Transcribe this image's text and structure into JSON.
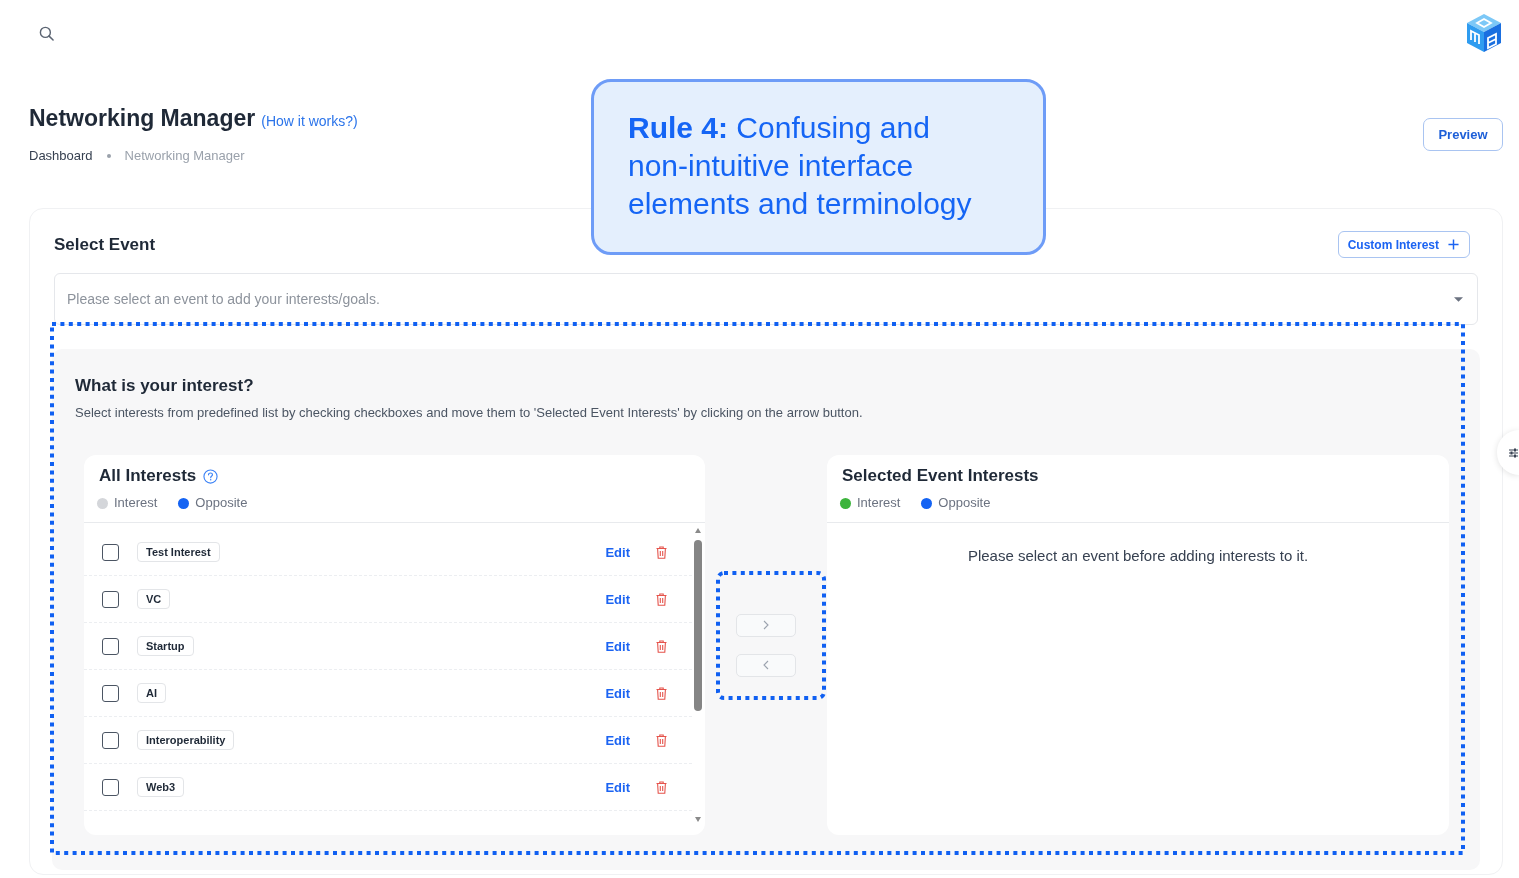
{
  "header": {
    "title": "Networking Manager",
    "help_link": "(How it works?)",
    "breadcrumb": [
      {
        "label": "Dashboard",
        "current": false
      },
      {
        "label": "Networking Manager",
        "current": true
      }
    ],
    "preview_button": "Preview"
  },
  "callout": {
    "text": "**Rule 4:** Confusing and non-intuitive interface elements and terminology"
  },
  "select_event": {
    "title": "Select Event",
    "custom_interest_button": "Custom Interest",
    "event_select": {
      "placeholder": "Please select an event to add your interests/goals."
    }
  },
  "interest_panel": {
    "title": "What is your interest?",
    "description": "Select interests from predefined list by checking checkboxes and move them to 'Selected Event Interests' by clicking on the arrow button.",
    "all_interests": {
      "title": "All Interests",
      "legend": [
        {
          "label": "Interest",
          "color": "#d4d6da"
        },
        {
          "label": "Opposite",
          "color": "#1463f3"
        }
      ],
      "items": [
        {
          "label": "Test Interest",
          "checked": false,
          "action": "Edit"
        },
        {
          "label": "VC",
          "checked": false,
          "action": "Edit"
        },
        {
          "label": "Startup",
          "checked": false,
          "action": "Edit"
        },
        {
          "label": "AI",
          "checked": false,
          "action": "Edit"
        },
        {
          "label": "Interoperability",
          "checked": false,
          "action": "Edit"
        },
        {
          "label": "Web3",
          "checked": false,
          "action": "Edit"
        }
      ]
    },
    "transfer_buttons": [
      {
        "kind": "move_right",
        "disabled": true
      },
      {
        "kind": "move_left",
        "disabled": true
      }
    ],
    "selected_interests": {
      "title": "Selected Event Interests",
      "legend": [
        {
          "label": "Interest",
          "color": "#3cb43c"
        },
        {
          "label": "Opposite",
          "color": "#1463f3"
        }
      ],
      "empty_message": "Please select an event before adding interests to it."
    }
  }
}
